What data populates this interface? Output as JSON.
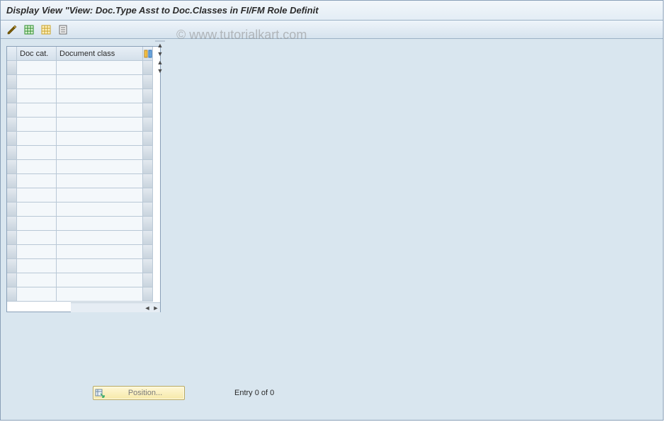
{
  "window": {
    "title": "Display View \"View: Doc.Type Asst to Doc.Classes in FI/FM Role Definit"
  },
  "watermark": "© www.tutorialkart.com",
  "toolbar": {
    "icons": {
      "toggle": "toggle-change-display-icon",
      "spreadsheet": "spreadsheet-icon",
      "table_export": "table-export-icon",
      "print": "print-icon"
    }
  },
  "grid": {
    "columns": [
      "Doc cat.",
      "Document class"
    ],
    "column_config_icon": "column-configuration-icon",
    "row_count": 17,
    "rows": [
      {
        "doc_cat": "",
        "doc_class": ""
      },
      {
        "doc_cat": "",
        "doc_class": ""
      },
      {
        "doc_cat": "",
        "doc_class": ""
      },
      {
        "doc_cat": "",
        "doc_class": ""
      },
      {
        "doc_cat": "",
        "doc_class": ""
      },
      {
        "doc_cat": "",
        "doc_class": ""
      },
      {
        "doc_cat": "",
        "doc_class": ""
      },
      {
        "doc_cat": "",
        "doc_class": ""
      },
      {
        "doc_cat": "",
        "doc_class": ""
      },
      {
        "doc_cat": "",
        "doc_class": ""
      },
      {
        "doc_cat": "",
        "doc_class": ""
      },
      {
        "doc_cat": "",
        "doc_class": ""
      },
      {
        "doc_cat": "",
        "doc_class": ""
      },
      {
        "doc_cat": "",
        "doc_class": ""
      },
      {
        "doc_cat": "",
        "doc_class": ""
      },
      {
        "doc_cat": "",
        "doc_class": ""
      },
      {
        "doc_cat": "",
        "doc_class": ""
      }
    ]
  },
  "footer": {
    "position_button": "Position...",
    "entry_text": "Entry 0 of 0"
  }
}
